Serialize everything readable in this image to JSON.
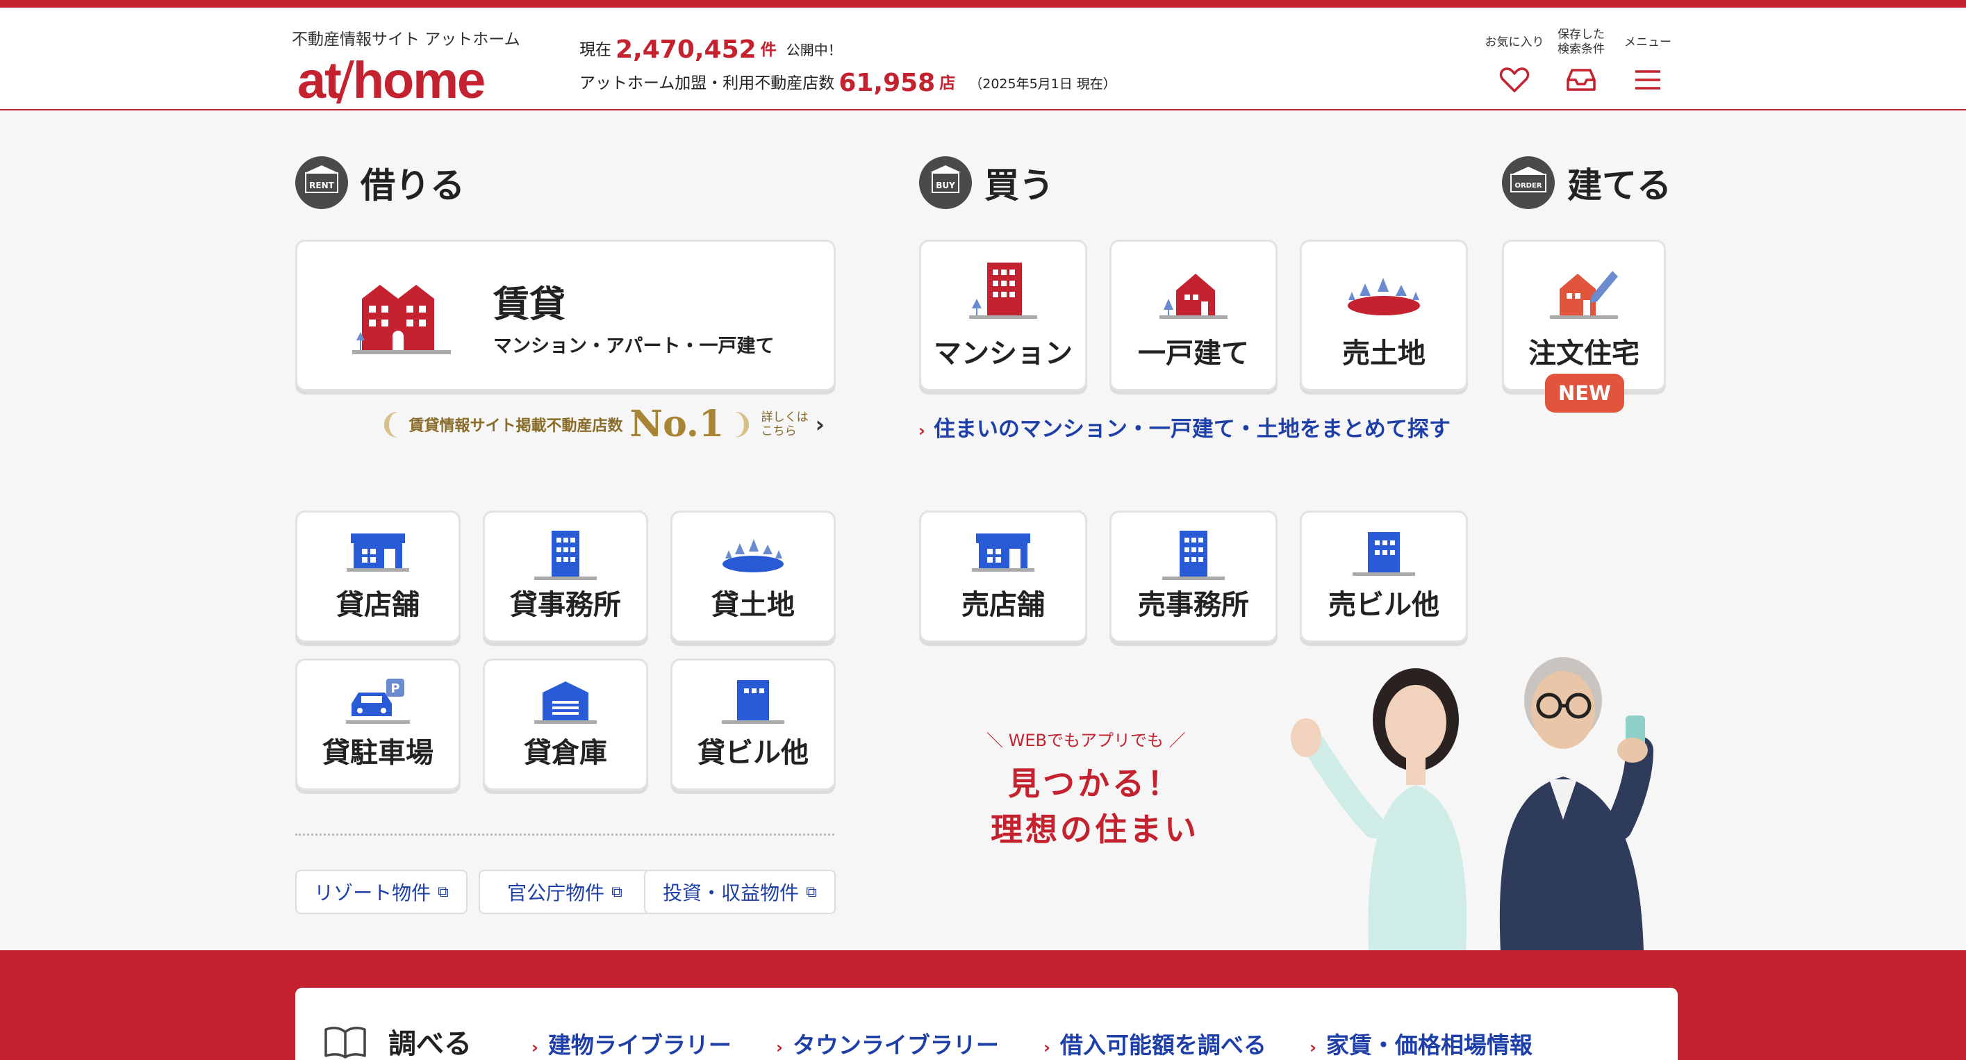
{
  "header": {
    "tagline": "不動産情報サイト アットホーム",
    "logo_left": "at",
    "logo_right": "home",
    "stat1_prefix": "現在",
    "stat1_count": "2,470,452",
    "stat1_unit": "件",
    "stat1_suffix": "公開中！",
    "stat2_prefix": "アットホーム加盟・利用不動産店数",
    "stat2_count": "61,958",
    "stat2_unit": "店",
    "stat2_date": "（2025年5月1日 現在）",
    "nav": [
      {
        "label": "お気に入り",
        "icon": "heart-icon"
      },
      {
        "label": "保存した検索条件",
        "icon": "inbox-icon"
      },
      {
        "label": "メニュー",
        "icon": "hamburger-icon"
      }
    ]
  },
  "rent": {
    "badge": "RENT",
    "title": "借りる",
    "main_card": {
      "label": "賃貸",
      "sub": "マンション・アパート・一戸建て"
    },
    "no1": {
      "text": "賃貸情報サイト掲載不動産店数",
      "rank": "No.1",
      "detail1": "詳しくは",
      "detail2": "こちら"
    },
    "cards": [
      "貸店舗",
      "貸事務所",
      "貸土地",
      "貸駐車場",
      "貸倉庫",
      "貸ビル他"
    ],
    "ext_links": [
      "リゾート物件",
      "官公庁物件",
      "投資・収益物件"
    ]
  },
  "buy": {
    "badge": "BUY",
    "title": "買う",
    "cards": [
      "マンション",
      "一戸建て",
      "売土地"
    ],
    "link": "住まいのマンション・一戸建て・土地をまとめて探す",
    "cards2": [
      "売店舗",
      "売事務所",
      "売ビル他"
    ]
  },
  "build": {
    "badge": "ORDER",
    "title": "建てる",
    "card": "注文住宅",
    "new_tag": "NEW"
  },
  "promo": {
    "sub": "WEBでもアプリでも",
    "line1": "見つかる！",
    "line2": "理想の住まい"
  },
  "research": {
    "title": "調べる",
    "links": [
      "建物ライブラリー",
      "タウンライブラリー",
      "借入可能額を調べる",
      "家賃・価格相場情報"
    ]
  },
  "colors": {
    "brand_red": "#c4222f",
    "link_blue": "#1e3fa8",
    "icon_blue": "#2a5bd7",
    "new_orange": "#e0553b"
  }
}
